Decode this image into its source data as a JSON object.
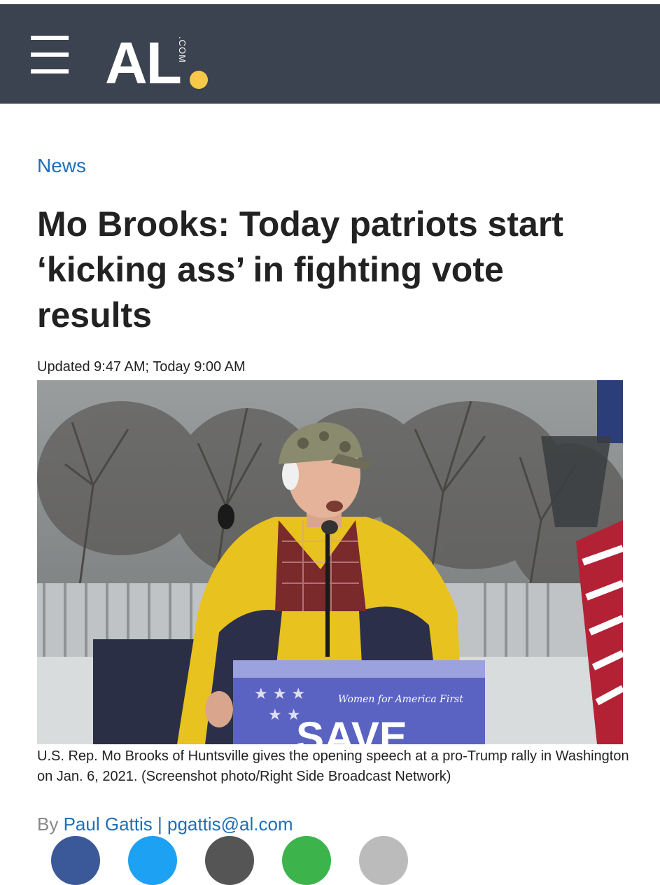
{
  "header": {
    "menu_icon": "hamburger-menu-icon",
    "logo_text": "AL",
    "logo_suffix": ".COM",
    "background_color": "#3b4350",
    "logo_dot_color": "#f7c948"
  },
  "article": {
    "section": "News",
    "headline": "Mo Brooks: Today patriots start ‘kicking ass’ in fighting vote results",
    "timestamp": "Updated 9:47 AM; Today 9:00 AM",
    "photo_caption": "U.S. Rep. Mo Brooks of Huntsville gives the opening speech at a pro-Trump rally in Washington on Jan. 6, 2021. (Screenshot photo/Right Side Broadcast Network)",
    "photo_podium_text": "SAVE",
    "photo_podium_logo": "Women for America First",
    "byline_prefix": "By",
    "author": "Paul Gattis",
    "separator": "|",
    "author_email": "pgattis@al.com"
  },
  "share_buttons": [
    {
      "icon": "facebook-icon",
      "color": "#3b5998"
    },
    {
      "icon": "twitter-icon",
      "color": "#1da1f2"
    },
    {
      "icon": "email-icon",
      "color": "#555555"
    },
    {
      "icon": "sms-icon",
      "color": "#3cb44b"
    },
    {
      "icon": "link-icon",
      "color": "#bbbbbb"
    }
  ],
  "colors": {
    "link": "#1f6fb5",
    "text": "#222222",
    "byline_muted": "#888888"
  }
}
